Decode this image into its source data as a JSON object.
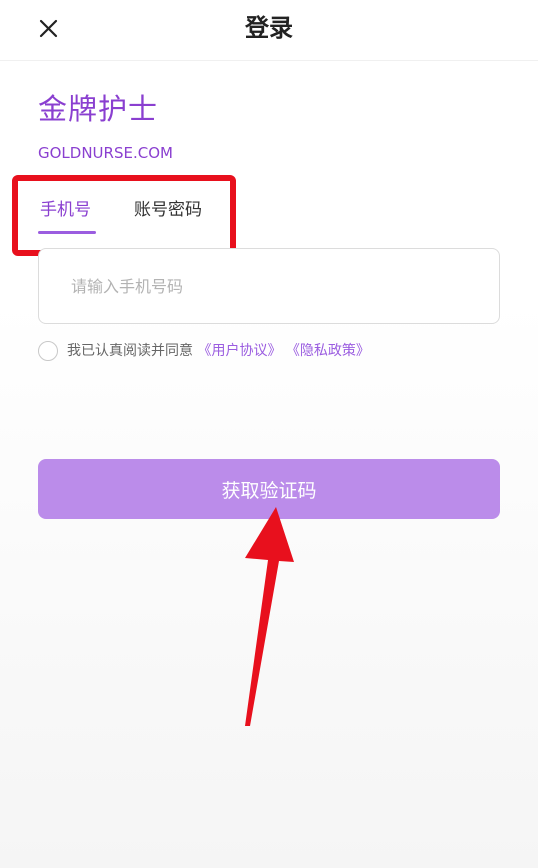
{
  "header": {
    "title": "登录",
    "close_icon": "close-icon"
  },
  "brand": {
    "name": "金牌护士",
    "url": "GOLDNURSE.COM",
    "color": "#8a3fd0"
  },
  "tabs": [
    {
      "label": "手机号",
      "active": true
    },
    {
      "label": "账号密码",
      "active": false
    }
  ],
  "phone_field": {
    "placeholder": "请输入手机号码",
    "value": ""
  },
  "agreement": {
    "checked": false,
    "text": "我已认真阅读并同意",
    "user_agreement": "《用户协议》",
    "privacy_policy": "《隐私政策》"
  },
  "submit": {
    "label": "获取验证码",
    "color": "#bb8cea"
  },
  "annotations": {
    "highlight_color": "#e8101d",
    "arrow_color": "#e8101d"
  }
}
